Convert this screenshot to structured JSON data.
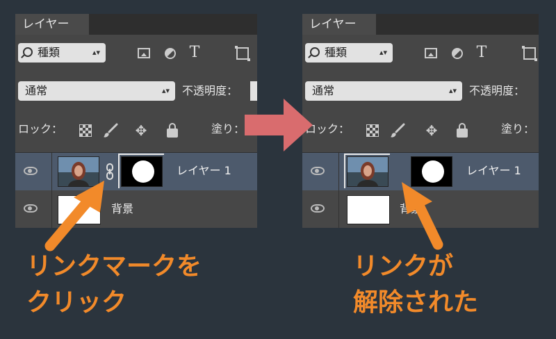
{
  "colors": {
    "background": "#2b343d",
    "accent": "#f28a2a",
    "arrow": "#d96c6e",
    "selected_row": "#4d5a6c"
  },
  "panels": [
    {
      "tab": "レイヤー",
      "filter": {
        "label": "種類"
      },
      "filter_icons": [
        "image-filter-icon",
        "adjustment-filter-icon",
        "type-filter-icon",
        "shape-filter-icon"
      ],
      "type_icon_glyph": "T",
      "blend_mode": "通常",
      "opacity_label": "不透明度：",
      "lock_label": "ロック：",
      "fill_label": "塗り：",
      "layers": [
        {
          "name": "レイヤー 1",
          "linked": true,
          "selected": true
        },
        {
          "name": "背景"
        }
      ]
    },
    {
      "tab": "レイヤー",
      "filter": {
        "label": "種類"
      },
      "type_icon_glyph": "T",
      "blend_mode": "通常",
      "opacity_label": "不透明度：",
      "lock_label": "ロック：",
      "fill_label": "塗り：",
      "layers": [
        {
          "name": "レイヤー 1",
          "linked": false,
          "selected": true
        },
        {
          "name": "背景"
        }
      ]
    }
  ],
  "captions": {
    "left": [
      "リンクマークを",
      "クリック"
    ],
    "right": [
      "リンクが",
      "解除された"
    ]
  }
}
